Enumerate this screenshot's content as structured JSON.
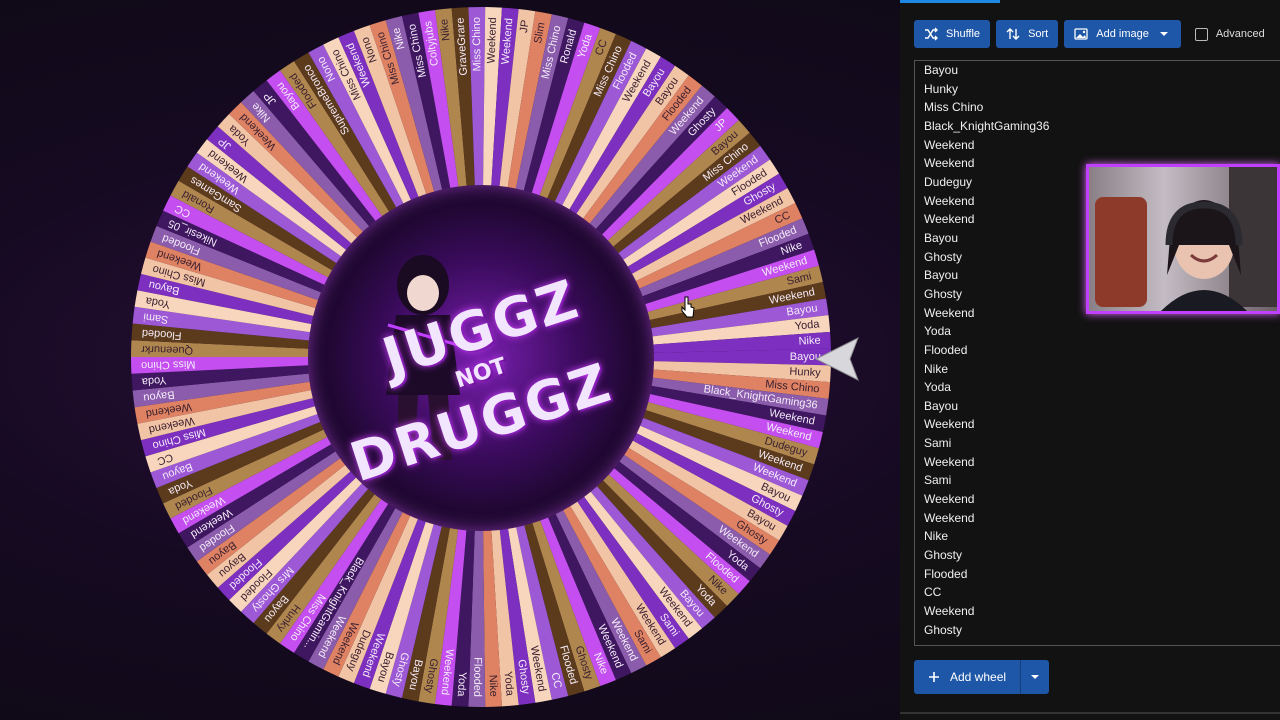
{
  "wheel": {
    "segment_colors": [
      "#7d2fc0",
      "#f2c4a6",
      "#df8263",
      "#8b5cab",
      "#3f1660",
      "#c44ef0",
      "#b0864f",
      "#5c3a1c",
      "#9d58d6",
      "#f7d6bd"
    ],
    "labels": [
      "Bayou",
      "Hunky",
      "Miss Chino",
      "Black_KnightGaming36",
      "Weekend",
      "Weekend",
      "Dudeguy",
      "Weekend",
      "Weekend",
      "Bayou",
      "Ghosty",
      "Bayou",
      "Ghosty",
      "Weekend",
      "Yoda",
      "Flooded",
      "Nike",
      "Yoda",
      "Bayou",
      "Weekend",
      "Sami",
      "Weekend",
      "Sami",
      "Weekend",
      "Weekend",
      "Nike",
      "Ghosty",
      "Flooded",
      "CC",
      "Weekend",
      "Ghosty",
      "Yoda",
      "Nike",
      "Flooded",
      "Yoda",
      "Weekend",
      "Ghosty",
      "Bayou",
      "Ghosty",
      "Bayou",
      "Weekend",
      "Dudeguy",
      "Weekend",
      "Weekend",
      "Black_KnightGamin...",
      "Miss Chino",
      "Hunky",
      "Bayou",
      "Mrs Ghosty",
      "Flooded",
      "Flooded",
      "Bayou",
      "Bayou",
      "Flooded",
      "Weekend",
      "Weekend",
      "Flooded",
      "Yoda",
      "Bayou",
      "CC",
      "Miss Chino",
      "Weekend",
      "Weekend",
      "Bayou",
      "Yoda",
      "Miss Chino",
      "Queenurkr",
      "Flooded",
      "Sami",
      "Yoda",
      "Bayou",
      "Miss Chino",
      "Weekend",
      "Flooded",
      "Nikesir_05",
      "CC",
      "Ronald",
      "SamGames",
      "Weekend",
      "Weekend",
      "JP",
      "Yoda",
      "Weekend",
      "Nike",
      "JP",
      "Bayou",
      "Flooded",
      "SupremeBronco",
      "Nono",
      "Miss Chino",
      "Weekend",
      "Nono",
      "Miss Chino",
      "Nike",
      "Miss Chino",
      "Coltyjubs",
      "Nike",
      "GraveGrare",
      "Miss Chino",
      "Weekend",
      "Weekend",
      "JP",
      "Slim",
      "Miss Chino",
      "Ronald",
      "Yoda",
      "CC",
      "Miss Chino",
      "Flooded",
      "Weekend",
      "Bayou",
      "Bayou",
      "Flooded",
      "Weekend",
      "Ghosty",
      "JP",
      "Bayou",
      "Miss Chino",
      "Weekend",
      "Flooded",
      "Ghosty",
      "Weekend",
      "CC",
      "Flooded",
      "Nike",
      "Weekend",
      "Sami",
      "Weekend",
      "Bayou",
      "Yoda",
      "Nike"
    ],
    "logo_top": "JUGGZ",
    "logo_mid": "NOT",
    "logo_bottom": "DRUGGZ"
  },
  "toolbar": {
    "shuffle_label": "Shuffle",
    "sort_label": "Sort",
    "add_image_label": "Add image",
    "advanced_label": "Advanced"
  },
  "entries": [
    "Bayou",
    "Hunky",
    "Miss Chino",
    "Black_KnightGaming36",
    "Weekend",
    "Weekend",
    "Dudeguy",
    "Weekend",
    "Weekend",
    "Bayou",
    "Ghosty",
    "Bayou",
    "Ghosty",
    "Weekend",
    "Yoda",
    "Flooded",
    "Nike",
    "Yoda",
    "Bayou",
    "Weekend",
    "Sami",
    "Weekend",
    "Sami",
    "Weekend",
    "Weekend",
    "Nike",
    "Ghosty",
    "Flooded",
    "CC",
    "Weekend",
    "Ghosty"
  ],
  "add_wheel_label": "Add wheel",
  "colors": {
    "accent_blue": "#1f57a8",
    "webcam_border": "#c040ff"
  }
}
